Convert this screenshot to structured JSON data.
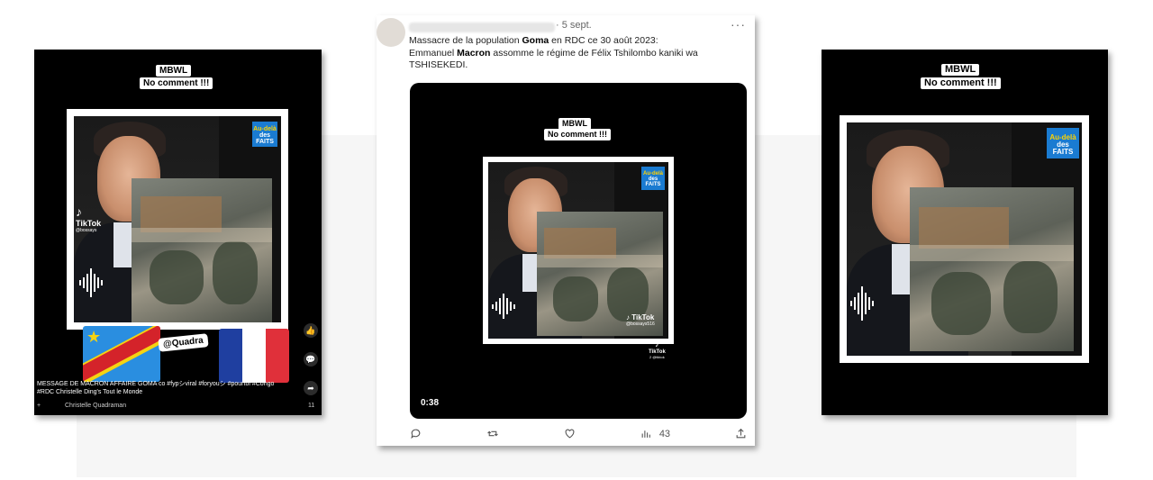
{
  "left_panel": {
    "caption_top": "MBWL",
    "caption_bottom": "No comment !!!",
    "badge_line1": "Au-delà",
    "badge_line2": "des FAITS",
    "tiktok_label": "TikTok",
    "tiktok_handle": "@bossays",
    "handle_tag": "@Quadra",
    "description_line1": "MESSAGE DE MACRON AFFAIRE GOMA co #fypシviral #foryouシ #pourtoi #Congo",
    "description_line2": "#RDC Christelle Ding's Tout le Monde",
    "author": "Christelle Quadraman",
    "footer_count": "11"
  },
  "tweet": {
    "date": "· 5 sept.",
    "more": "···",
    "text_part1": "Massacre de la  population ",
    "text_bold1": "Goma",
    "text_part2": " en RDC ce 30 août 2023:",
    "text_part3": "Emmanuel ",
    "text_bold2": "Macron",
    "text_part4": " assomme le régime de Félix Tshilombo kaniki wa",
    "text_part5": "TSHISEKEDI.",
    "video": {
      "caption_top": "MBWL",
      "caption_bottom": "No comment !!!",
      "badge_line1": "Au-delà",
      "badge_line2": "des FAITS",
      "tiktok_label": "TikTok",
      "tiktok_handle": "@bossays516",
      "tiktok_label2": "TikTok",
      "tiktok_handle2": "2 @tiktok",
      "duration": "0:38"
    },
    "views": "43"
  },
  "right_panel": {
    "caption_top": "MBWL",
    "caption_bottom": "No comment !!!",
    "badge_line1": "Au-delà",
    "badge_line2": "des FAITS"
  },
  "colors": {
    "badge_blue": "#1a7bd1",
    "flag_drc_blue": "#2a8ee0",
    "flag_drc_red": "#d4232a",
    "flag_drc_yellow": "#f5d312",
    "flag_fr_blue": "#1f3fa0",
    "flag_fr_red": "#e0303a"
  }
}
